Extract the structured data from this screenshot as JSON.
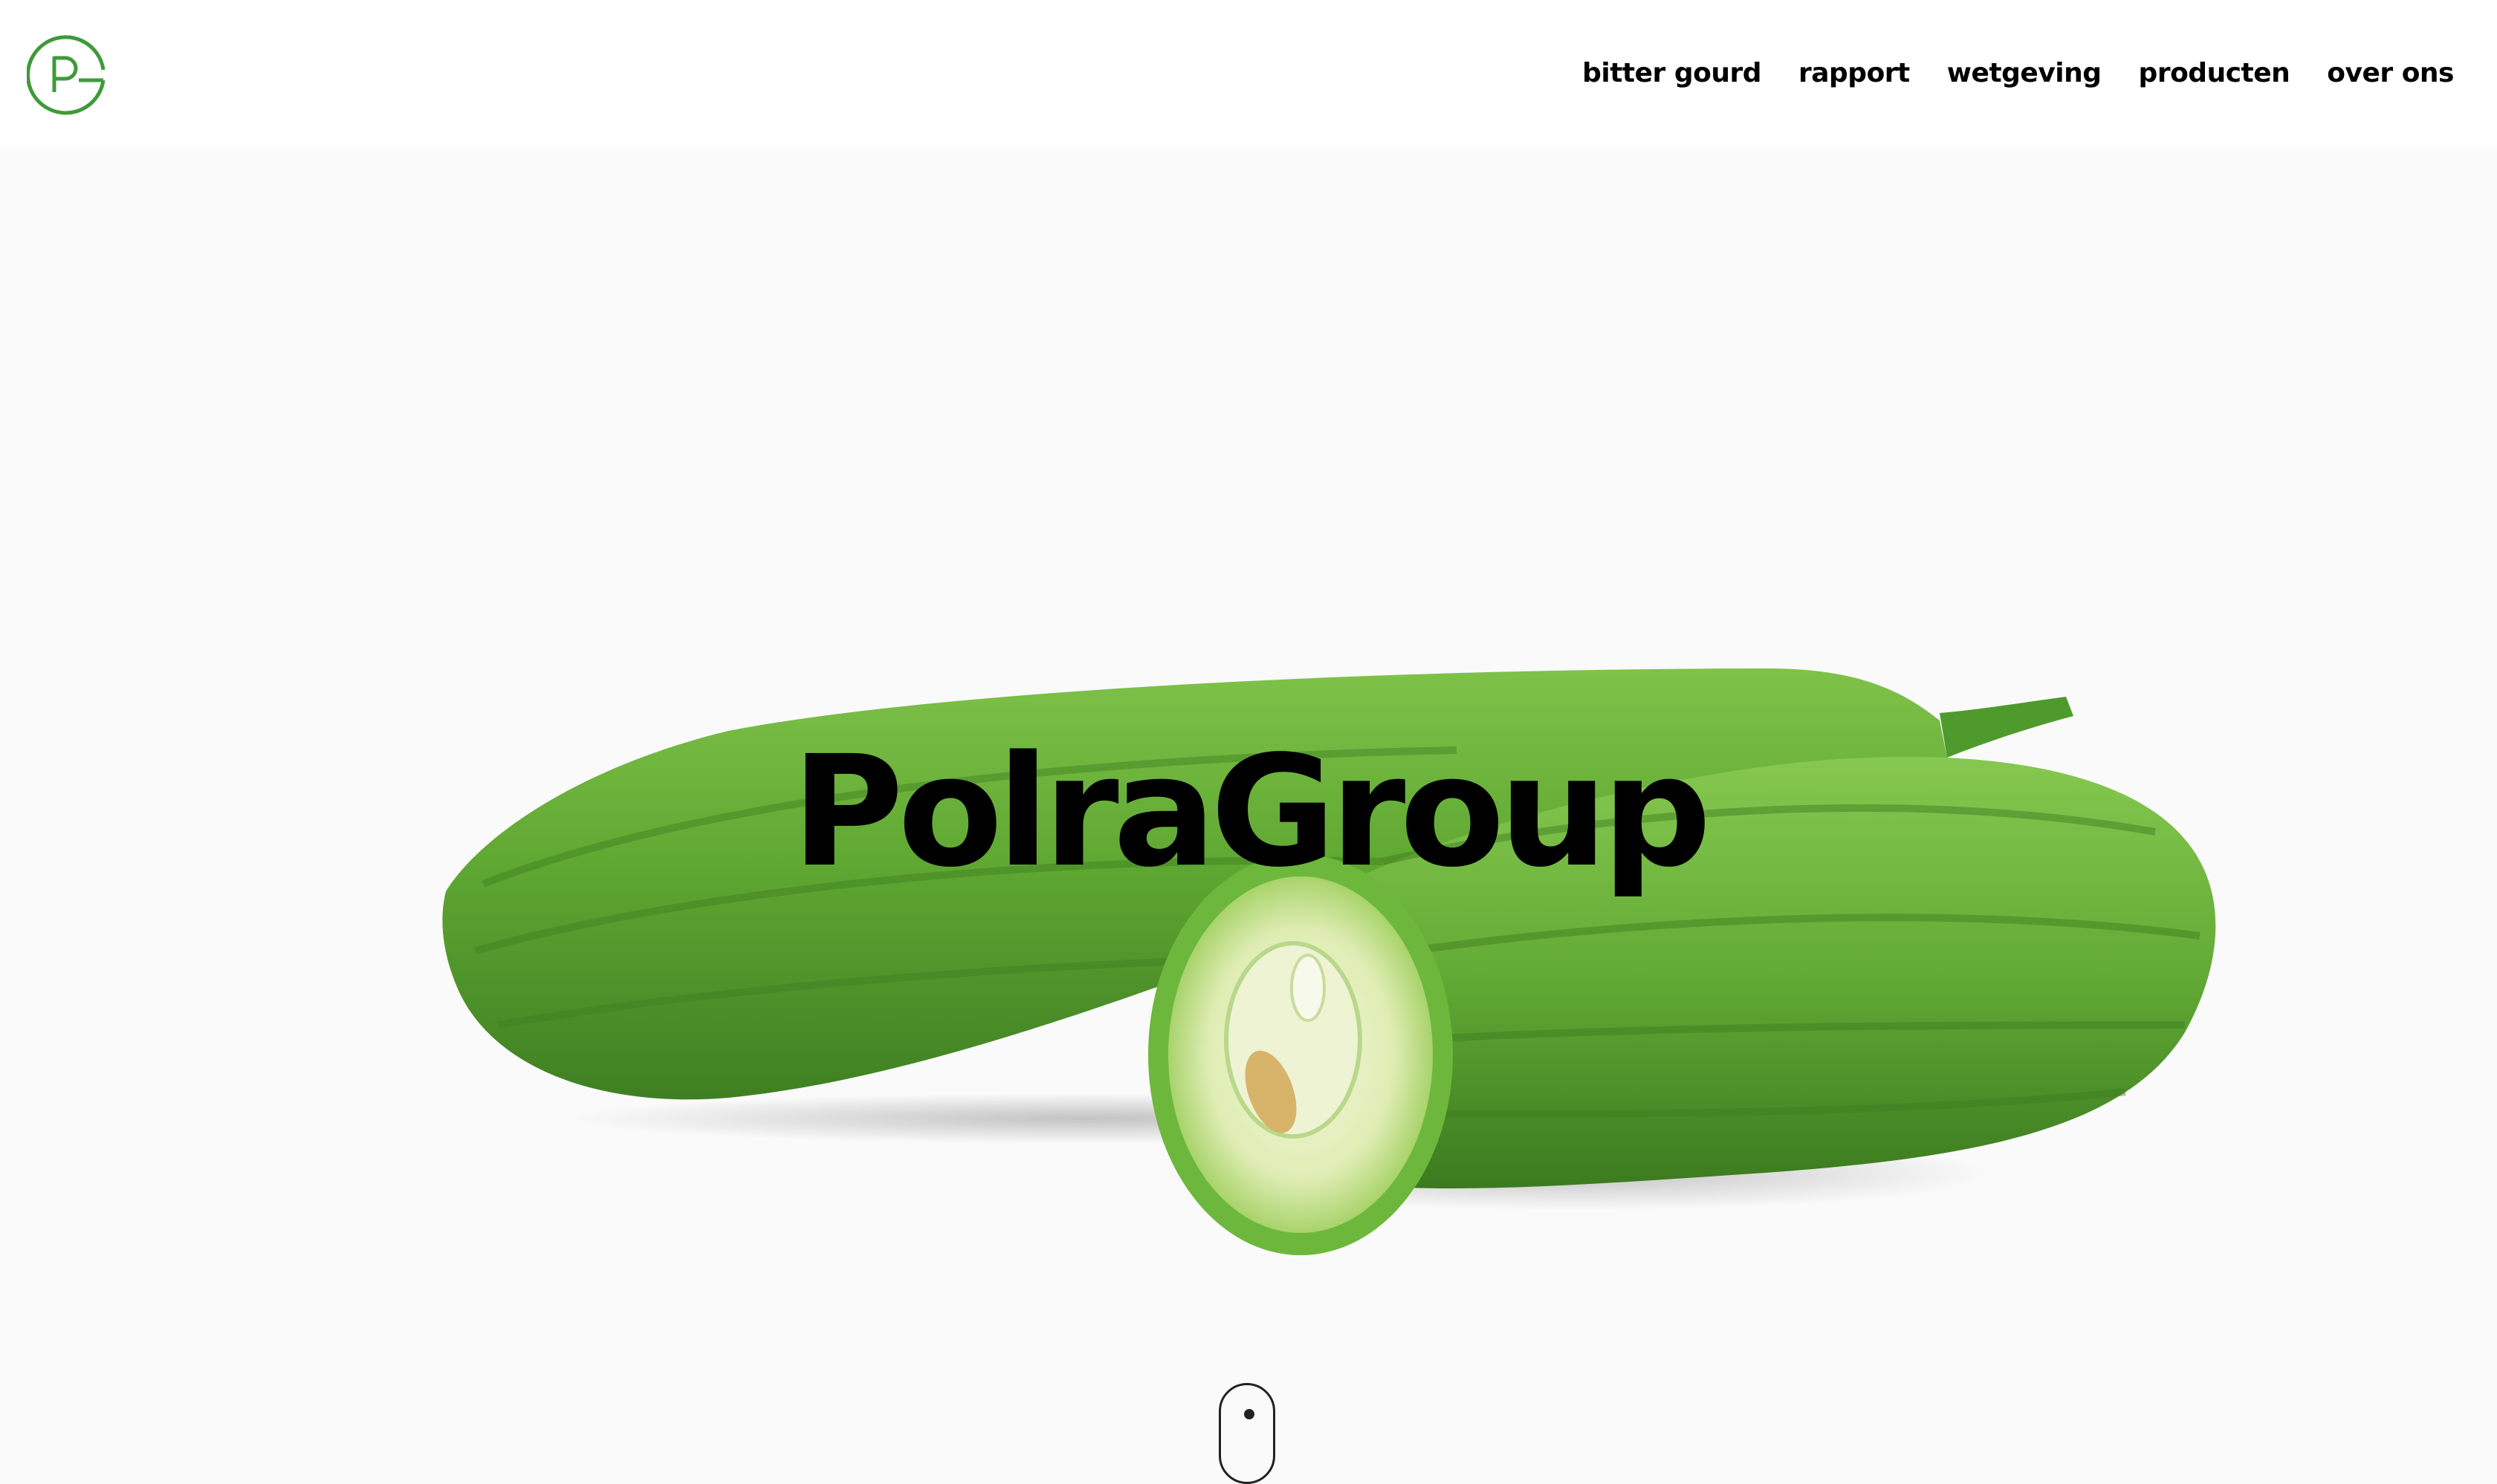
{
  "header": {
    "logo_letters": "PG",
    "nav": [
      {
        "label": "bitter gourd"
      },
      {
        "label": "rapport"
      },
      {
        "label": "wetgeving"
      },
      {
        "label": "producten"
      },
      {
        "label": "over ons"
      }
    ]
  },
  "hero": {
    "title": "PolraGroup",
    "image": "bitter-gourd-photo"
  },
  "colors": {
    "brand_green": "#3f9a3a",
    "background": "#fafafa",
    "header_bg": "#ffffff",
    "text": "#000000"
  }
}
